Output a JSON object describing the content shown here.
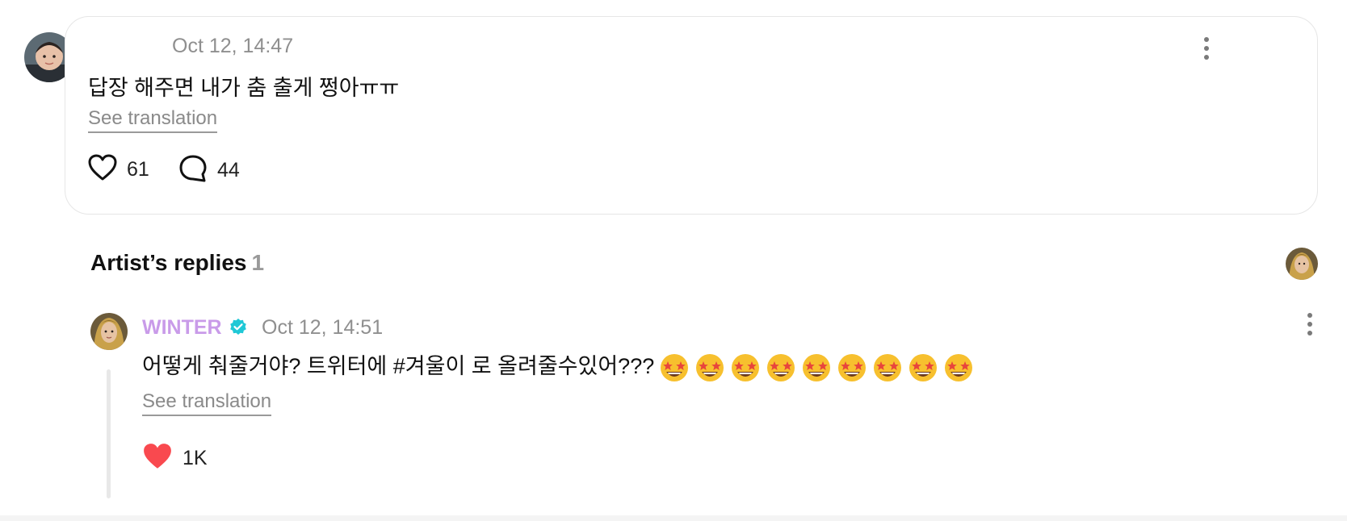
{
  "post": {
    "timestamp": "Oct 12, 14:47",
    "text": "답장 해주면 내가 춤 출게 쩡아ㅠㅠ",
    "see_translation": "See translation",
    "likes": "61",
    "comments": "44"
  },
  "artist_replies": {
    "title": "Artist’s replies",
    "count": "1"
  },
  "reply": {
    "author": "WINTER",
    "timestamp": "Oct 12, 14:51",
    "text": "어떻게 춰줄거야? 트위터에 #겨울이 로 올려줄수있어???",
    "emoji": "🤩🤩🤩🤩🤩🤩🤩🤩🤩",
    "see_translation": "See translation",
    "likes": "1K"
  },
  "icons": {
    "heart": "heart-outline-icon",
    "comment": "comment-bubble-icon",
    "heart_filled": "heart-filled-icon",
    "verified": "verified-badge-icon",
    "more": "more-vertical-icon",
    "emoji": "star-struck-emoji"
  },
  "colors": {
    "artist_name": "#c99be9",
    "verified": "#1fc8d6",
    "heart_filled": "#f9494f",
    "muted_text": "#8f8f8f",
    "card_border": "#e6e6e6"
  }
}
